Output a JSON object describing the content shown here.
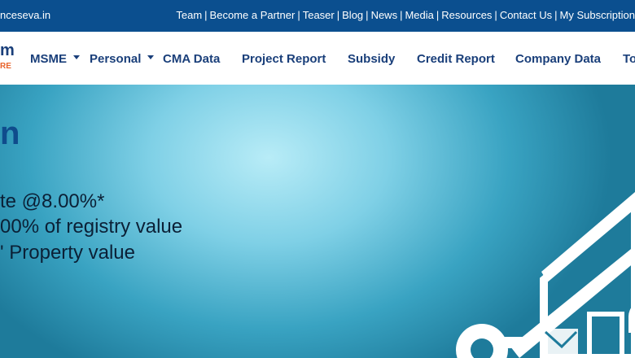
{
  "topbar": {
    "site": "nceseva.in",
    "links": [
      "Team",
      "Become a Partner",
      "Teaser",
      "Blog",
      "News",
      "Media",
      "Resources",
      "Contact Us",
      "My Subscription"
    ]
  },
  "logo": {
    "line1": "m",
    "line2": "RE"
  },
  "nav": {
    "items": [
      {
        "label": "MSME",
        "dropdown": true
      },
      {
        "label": "Personal",
        "dropdown": true
      },
      {
        "label": "CMA Data",
        "dropdown": false
      },
      {
        "label": "Project Report",
        "dropdown": false
      },
      {
        "label": "Subsidy",
        "dropdown": false
      },
      {
        "label": "Credit Report",
        "dropdown": false
      },
      {
        "label": "Company Data",
        "dropdown": false
      },
      {
        "label": "To",
        "dropdown": false
      }
    ]
  },
  "hero": {
    "title": "n",
    "lines": [
      "te @8.00%*",
      "00% of registry value",
      "' Property value"
    ],
    "illustration": "house-with-key-icon"
  },
  "colors": {
    "topbar_bg": "#0b4f8f",
    "nav_text": "#1a3f7a",
    "logo_accent": "#e8622a",
    "hero_title": "#0f4c8c"
  }
}
